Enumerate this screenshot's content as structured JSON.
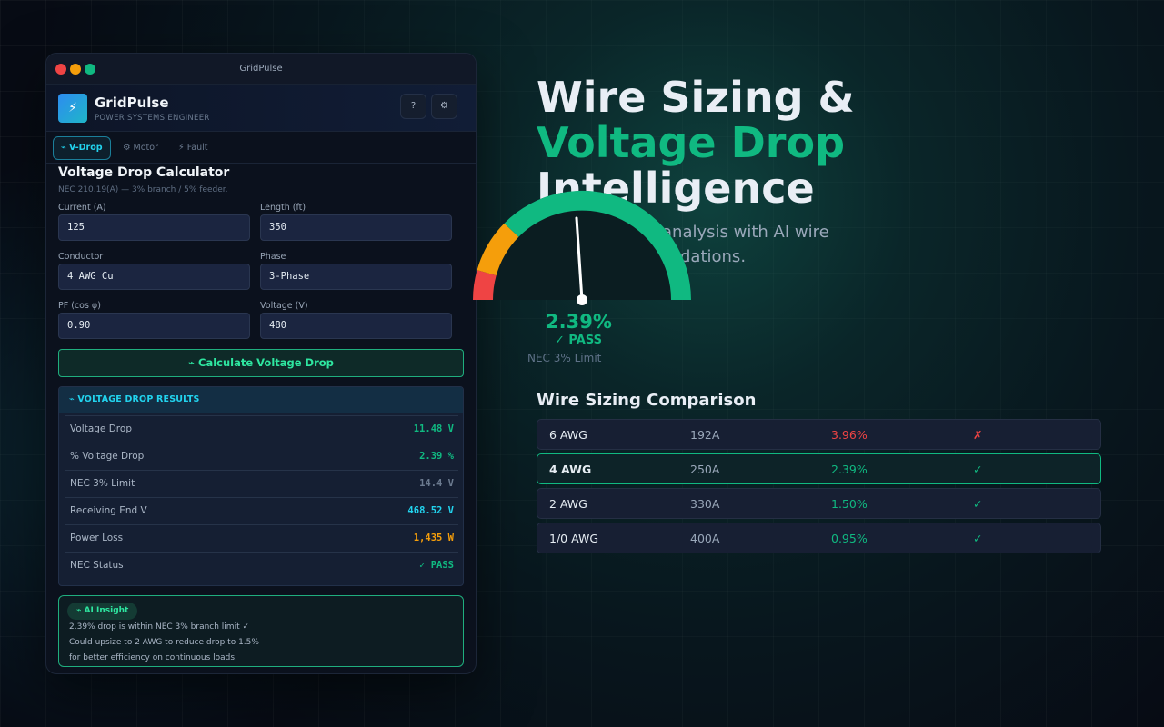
{
  "window": {
    "title": "GridPulse"
  },
  "header": {
    "app_name": "GridPulse",
    "subtitle": "POWER SYSTEMS ENGINEER",
    "logo_glyph": "⚡",
    "help_label": "?",
    "settings_glyph": "⚙"
  },
  "tabs": [
    {
      "label": "⌁ V-Drop",
      "active": true
    },
    {
      "label": "⚙ Motor",
      "active": false
    },
    {
      "label": "⚡ Fault",
      "active": false
    }
  ],
  "calculator": {
    "title": "Voltage Drop Calculator",
    "subtitle": "NEC 210.19(A) — 3% branch / 5% feeder.",
    "fields": {
      "current": {
        "label": "Current (A)",
        "value": "125"
      },
      "length": {
        "label": "Length (ft)",
        "value": "350"
      },
      "conductor": {
        "label": "Conductor",
        "value": "4 AWG Cu"
      },
      "phase": {
        "label": "Phase",
        "value": "3-Phase"
      },
      "pf": {
        "label": "PF (cos φ)",
        "value": "0.90"
      },
      "voltage": {
        "label": "Voltage (V)",
        "value": "480"
      }
    },
    "button_label": "⌁ Calculate Voltage Drop"
  },
  "results": {
    "heading": "⌁ VOLTAGE DROP RESULTS",
    "rows": [
      {
        "label": "Voltage Drop",
        "value": "11.48 V",
        "color": "#10b981"
      },
      {
        "label": "% Voltage Drop",
        "value": "2.39 %",
        "color": "#10b981"
      },
      {
        "label": "NEC 3% Limit",
        "value": "14.4 V",
        "color": "#6b7a8f"
      },
      {
        "label": "Receiving End V",
        "value": "468.52 V",
        "color": "#22d3ee"
      },
      {
        "label": "Power Loss",
        "value": "1,435 W",
        "color": "#f59e0b"
      },
      {
        "label": "NEC Status",
        "value": "✓ PASS",
        "color": "#10b981"
      }
    ]
  },
  "insight": {
    "badge": "⌁ AI Insight",
    "lines": [
      "2.39% drop is within NEC 3% branch limit ✓",
      "Could upsize to 2 AWG to reduce drop to 1.5%",
      "for better efficiency on continuous loads."
    ]
  },
  "hero": {
    "line1": "Wire Sizing &",
    "line2": "Voltage Drop",
    "line3": "Intelligence",
    "sub_line1": "analysis with AI wire",
    "sub_line2": "dations."
  },
  "gauge": {
    "value_label": "2.39%",
    "status": "✓ PASS",
    "limit_label": "NEC 3% Limit",
    "value_pct": 2.39,
    "colors": {
      "red": "#ef4444",
      "amber": "#f59e0b",
      "green": "#10b981"
    }
  },
  "comparison": {
    "title": "Wire Sizing Comparison",
    "rows": [
      {
        "awg": "6 AWG",
        "amps": "192A",
        "drop": "3.96%",
        "ok": "✗",
        "pass": false,
        "selected": false
      },
      {
        "awg": "4 AWG",
        "amps": "250A",
        "drop": "2.39%",
        "ok": "✓",
        "pass": true,
        "selected": true
      },
      {
        "awg": "2 AWG",
        "amps": "330A",
        "drop": "1.50%",
        "ok": "✓",
        "pass": true,
        "selected": false
      },
      {
        "awg": "1/0 AWG",
        "amps": "400A",
        "drop": "0.95%",
        "ok": "✓",
        "pass": true,
        "selected": false
      }
    ]
  },
  "colors": {
    "dot_red": "#ef4444",
    "dot_amber": "#f59e0b",
    "dot_green": "#10b981",
    "pass": "#10b981",
    "fail": "#ef4444"
  }
}
